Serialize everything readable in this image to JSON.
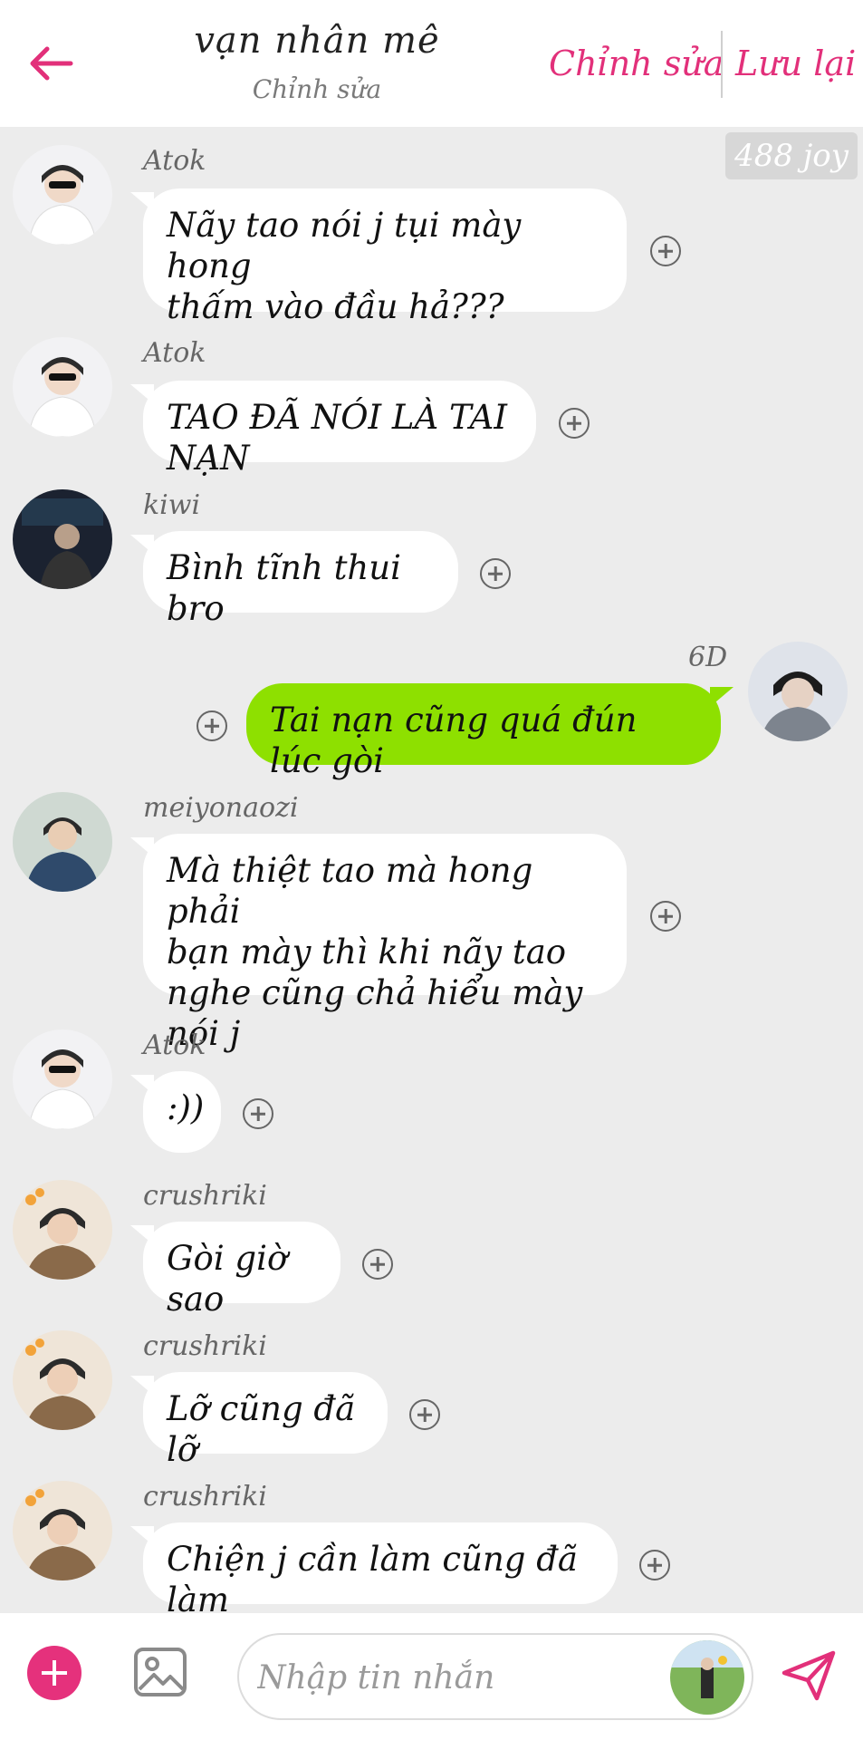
{
  "header": {
    "title": "vạn nhân mê",
    "subtitle": "Chỉnh sửa",
    "edit_label": "Chỉnh sửa",
    "save_label": "Lưu lại"
  },
  "watermark": "488 joy",
  "messages": [
    {
      "sender": "Atok",
      "text": [
        "Nãy tao nói j tụi mày hong",
        "thấm vào đầu hả???"
      ],
      "avatar": "atok-avatar"
    },
    {
      "sender": "Atok",
      "text": [
        "TAO ĐÃ NÓI LÀ TAI NẠN"
      ],
      "avatar": "atok-avatar"
    },
    {
      "sender": "kiwi",
      "text": [
        "Bình tĩnh thui bro"
      ],
      "avatar": "kiwi-avatar"
    },
    {
      "sender": "6D",
      "text": [
        "Tai nạn cũng quá đún lúc gòi"
      ],
      "avatar": "6d-avatar",
      "mine": true
    },
    {
      "sender": "meiyonaozi",
      "text": [
        "Mà thiệt tao mà hong phải",
        "bạn mày thì khi nãy tao",
        "nghe cũng chả hiểu mày nói j"
      ],
      "avatar": "meiyonaozi-avatar"
    },
    {
      "sender": "Atok",
      "text": [
        ":))"
      ],
      "avatar": "atok-avatar"
    },
    {
      "sender": "crushriki",
      "text": [
        "Gòi giờ sao"
      ],
      "avatar": "crushriki-avatar"
    },
    {
      "sender": "crushriki",
      "text": [
        "Lỡ cũng đã lỡ"
      ],
      "avatar": "crushriki-avatar"
    },
    {
      "sender": "crushriki",
      "text": [
        "Chiện j cần làm cũng đã làm"
      ],
      "avatar": "crushriki-avatar"
    }
  ],
  "composer": {
    "placeholder": "Nhập tin nhắn"
  },
  "colors": {
    "accent": "#e2307a",
    "mine_bubble": "#8ee000",
    "other_bubble": "#ffffff",
    "background": "#ececec"
  }
}
